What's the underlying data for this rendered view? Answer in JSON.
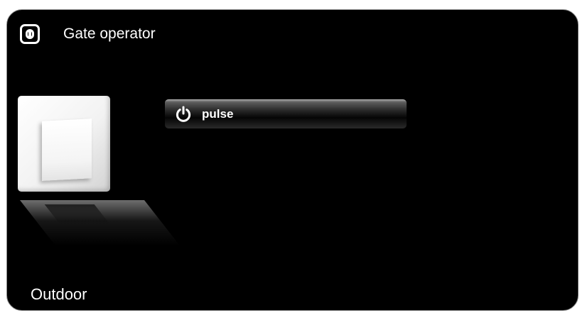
{
  "header": {
    "title": "Gate operator",
    "icon": "gate-operator-icon"
  },
  "device": {
    "image": "wall-switch-illustration"
  },
  "actions": [
    {
      "label": "pulse",
      "icon": "power-icon"
    }
  ],
  "footer": {
    "location": "Outdoor"
  },
  "colors": {
    "background": "#000000",
    "border": "#8a8a8a",
    "text": "#ffffff",
    "page": "#ffffff"
  }
}
